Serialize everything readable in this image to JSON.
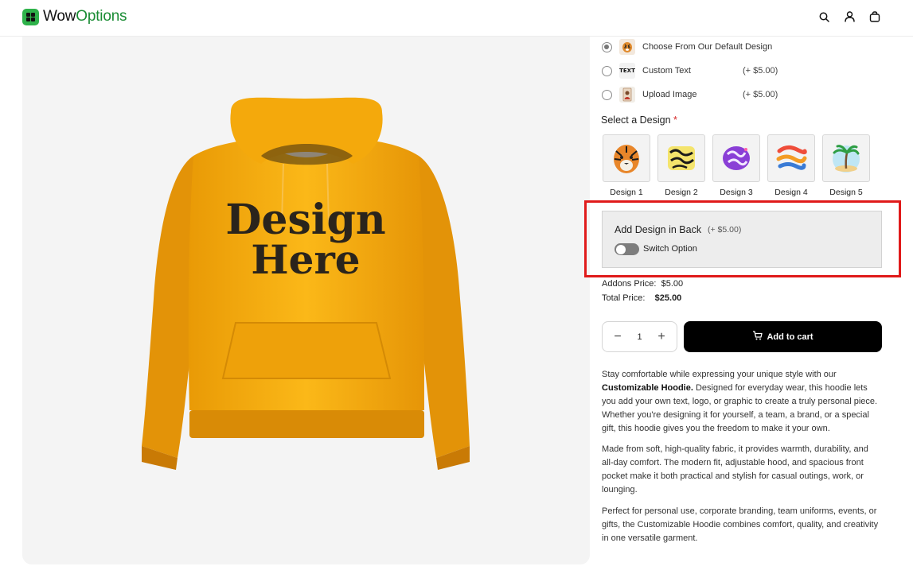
{
  "header": {
    "logo_part1": "Wow",
    "logo_part2": "Options",
    "icons": [
      "search-icon",
      "user-icon",
      "bag-icon"
    ]
  },
  "options": [
    {
      "label": "Choose From Our Default Design",
      "price": "",
      "selected": true
    },
    {
      "label": "Custom Text",
      "price": "(+ $5.00)",
      "selected": false
    },
    {
      "label": "Upload Image",
      "price": "(+ $5.00)",
      "selected": false
    }
  ],
  "option_thumb_text": "TEXT",
  "select_design": {
    "title": "Select a Design",
    "required_mark": "*",
    "items": [
      {
        "label": "Design 1"
      },
      {
        "label": "Design 2"
      },
      {
        "label": "Design 3"
      },
      {
        "label": "Design 4"
      },
      {
        "label": "Design 5"
      }
    ]
  },
  "addon": {
    "title": "Add Design in Back",
    "price": "(+ $5.00)",
    "toggle_label": "Switch Option",
    "toggle_on": false
  },
  "pricing": {
    "addons_label": "Addons Price:",
    "addons_value": "$5.00",
    "total_label": "Total Price:",
    "total_value": "$25.00"
  },
  "quantity": {
    "value": "1",
    "minus": "−",
    "plus": "+"
  },
  "cart": {
    "label": "Add to cart"
  },
  "product_image": {
    "text_line1": "Design",
    "text_line2": "Here",
    "color": "#f5ad0d"
  },
  "description": {
    "p1_a": "Stay comfortable while expressing your unique style with our",
    "p1_bold": "Customizable Hoodie.",
    "p1_b": "Designed for everyday wear, this hoodie lets you add your own text, logo, or graphic to create a truly personal piece. Whether you're designing it for yourself, a team, a brand, or a special gift, this hoodie gives you the freedom to make it your own.",
    "p2": "Made from soft, high-quality fabric, it provides warmth, durability, and all-day comfort. The modern fit, adjustable hood, and spacious front pocket make it both practical and stylish for casual outings, work, or lounging.",
    "p3": "Perfect for personal use, corporate branding, team uniforms, events, or gifts, the Customizable Hoodie combines comfort, quality, and creativity in one versatile garment."
  },
  "colors": {
    "accent_green": "#1a8c34",
    "highlight_red": "#e01a1a",
    "cart_button": "#000000"
  }
}
